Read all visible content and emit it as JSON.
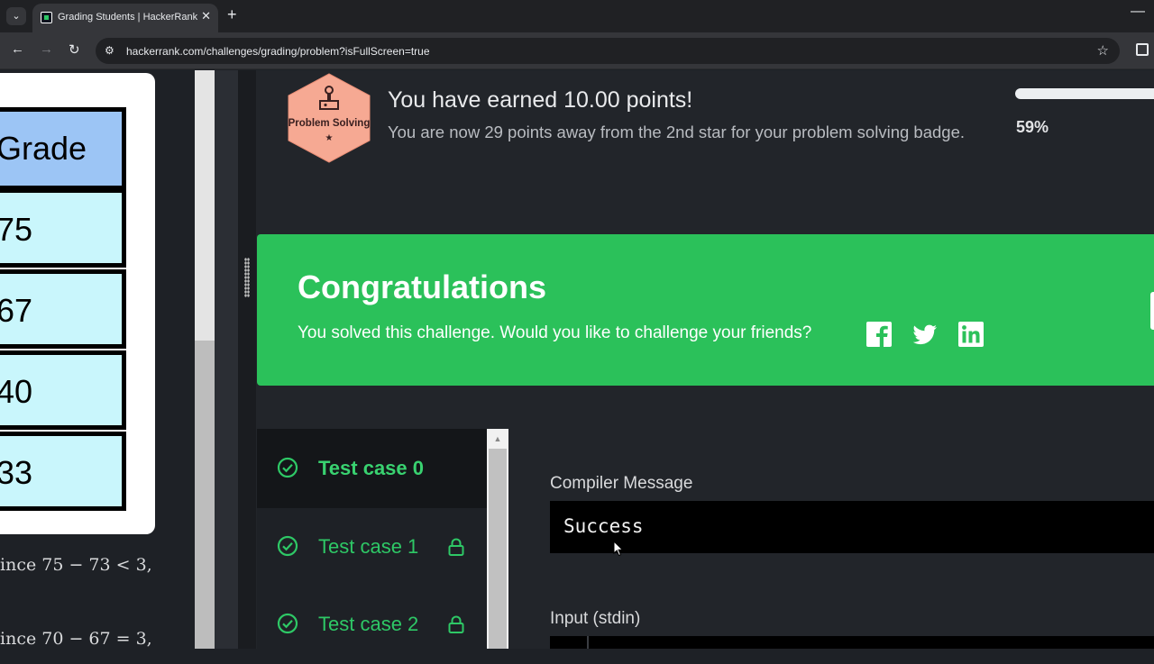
{
  "browser": {
    "tab_title": "Grading Students | HackerRank",
    "url": "hackerrank.com/challenges/grading/problem?isFullScreen=true"
  },
  "problem": {
    "grade_header": "Grade",
    "grades": [
      "75",
      "67",
      "40",
      "33"
    ],
    "notes": [
      "ince 75 − 73 < 3,",
      "ince 70 − 67 = 3,"
    ]
  },
  "badge": {
    "label": "Problem Solving",
    "stars": "★",
    "color": "#f6a993"
  },
  "points": {
    "title": "You have earned 10.00 points!",
    "subtitle": "You are now 29 points away from the 2nd star for your problem solving badge.",
    "progress_percent": "59%"
  },
  "congrats": {
    "title": "Congratulations",
    "subtitle": "You solved this challenge. Would you like to challenge your friends?",
    "share_icons": [
      "facebook-icon",
      "twitter-icon",
      "linkedin-icon"
    ],
    "color": "#2bc15a"
  },
  "test_cases": [
    {
      "label": "Test case 0",
      "locked": false,
      "active": true
    },
    {
      "label": "Test case 1",
      "locked": true,
      "active": false
    },
    {
      "label": "Test case 2",
      "locked": true,
      "active": false
    }
  ],
  "output": {
    "compiler_label": "Compiler Message",
    "compiler_message": "Success",
    "input_label": "Input (stdin)"
  }
}
